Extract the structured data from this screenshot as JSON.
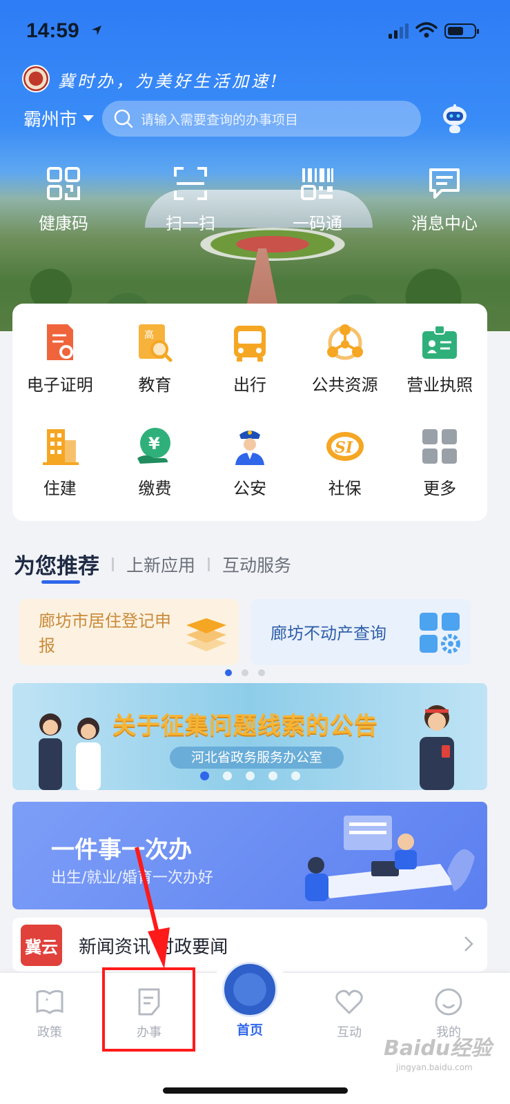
{
  "status_bar": {
    "time": "14:59"
  },
  "header": {
    "slogan": "冀时办，为美好生活加速!",
    "city": "霸州市",
    "search_placeholder": "请输入需要查询的办事项目"
  },
  "quick_actions": [
    {
      "label": "健康码",
      "icon": "health-code-icon"
    },
    {
      "label": "扫一扫",
      "icon": "scan-icon"
    },
    {
      "label": "一码通",
      "icon": "barcode-icon"
    },
    {
      "label": "消息中心",
      "icon": "message-icon"
    }
  ],
  "services": [
    {
      "label": "电子证明",
      "icon": "certificate-icon",
      "color": "#f0643c"
    },
    {
      "label": "教育",
      "icon": "education-icon",
      "color": "#f5a623"
    },
    {
      "label": "出行",
      "icon": "bus-icon",
      "color": "#f5a623"
    },
    {
      "label": "公共资源",
      "icon": "public-resource-icon",
      "color": "#f5a623"
    },
    {
      "label": "营业执照",
      "icon": "business-license-icon",
      "color": "#2fb07a"
    },
    {
      "label": "住建",
      "icon": "building-icon",
      "color": "#f5a623"
    },
    {
      "label": "缴费",
      "icon": "payment-icon",
      "color": "#2fb07a"
    },
    {
      "label": "公安",
      "icon": "police-icon",
      "color": "#2f66ea"
    },
    {
      "label": "社保",
      "icon": "social-security-icon",
      "color": "#f5a623"
    },
    {
      "label": "更多",
      "icon": "more-grid-icon",
      "color": "#9aa0a8"
    }
  ],
  "tabs": [
    "为您推荐",
    "上新应用",
    "互动服务"
  ],
  "recommend": [
    {
      "label": "廊坊市居住登记申报",
      "icon": "layers-icon"
    },
    {
      "label": "廊坊不动产查询",
      "icon": "apps-gear-icon"
    }
  ],
  "banner": {
    "title": "关于征集问题线索的公告",
    "subtitle": "河北省政务服务办公室"
  },
  "promo": {
    "title": "一件事一次办",
    "subtitle": "出生/就业/婚育一次办好"
  },
  "news": {
    "logo": "冀云",
    "title": "新闻资讯 时政要闻"
  },
  "tabbar": [
    {
      "label": "政策",
      "icon": "policy-book-icon"
    },
    {
      "label": "办事",
      "icon": "document-icon"
    },
    {
      "label": "首页",
      "icon": "home-emblem-icon"
    },
    {
      "label": "互动",
      "icon": "heart-icon"
    },
    {
      "label": "我的",
      "icon": "smile-icon"
    }
  ],
  "watermark": {
    "brand": "Baidu经验",
    "url": "jingyan.baidu.com"
  },
  "colors": {
    "primary": "#2f66ea",
    "annotation": "#ff1a1a"
  }
}
